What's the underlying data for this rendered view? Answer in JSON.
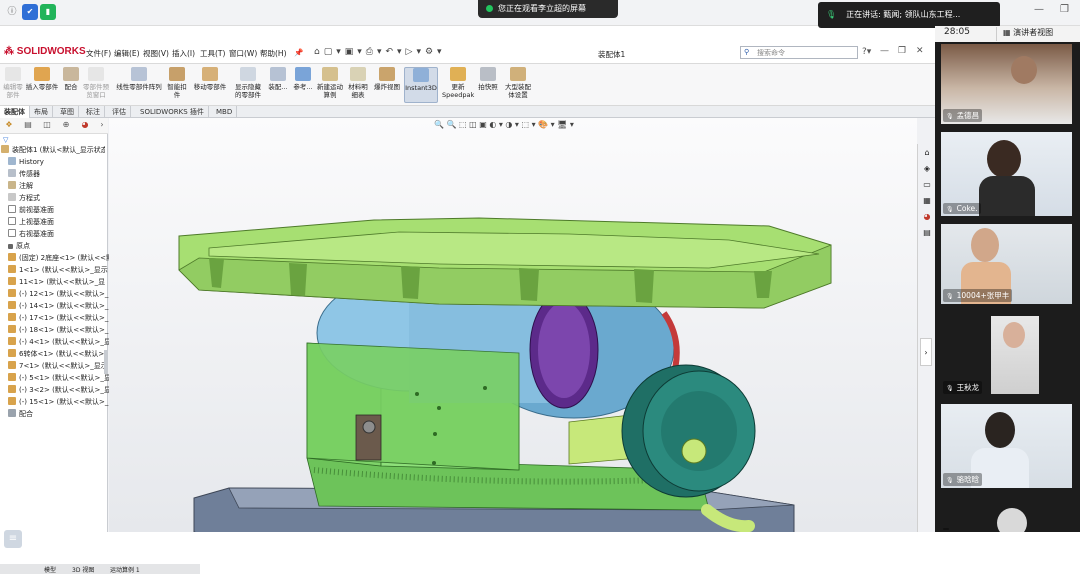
{
  "meeting": {
    "share_banner": "您正在观看李立超的屏幕",
    "speaking_label": "正在讲话: 甄闻; 领队山东工程...",
    "timer": "28:05",
    "view_mode": "演讲者视图",
    "top_icons": [
      "info-icon",
      "shield-icon",
      "signal-icon"
    ],
    "participants": [
      {
        "name": "孟德昌"
      },
      {
        "name": "Coke."
      },
      {
        "name": "10004+张甲丰"
      },
      {
        "name": "王秋龙"
      },
      {
        "name": "骆晗晗"
      },
      {
        "name": ""
      }
    ]
  },
  "solidworks": {
    "logo": "SOLIDWORKS",
    "menu": [
      "文件(F)",
      "编辑(E)",
      "视图(V)",
      "插入(I)",
      "工具(T)",
      "窗口(W)",
      "帮助(H)"
    ],
    "doc_title": "装配体1",
    "search_placeholder": "搜索命令",
    "ribbon": [
      {
        "label": "编辑零部件"
      },
      {
        "label": "插入零部件"
      },
      {
        "label": "配合"
      },
      {
        "label": "零部件预览窗口"
      },
      {
        "label": "线性零部件阵列"
      },
      {
        "label": "智能扣件"
      },
      {
        "label": "移动零部件"
      },
      {
        "label": "显示隐藏的零部件"
      },
      {
        "label": "装配..."
      },
      {
        "label": "参考..."
      },
      {
        "label": "新建运动算例"
      },
      {
        "label": "材料明细表"
      },
      {
        "label": "爆炸视图"
      },
      {
        "label": "Instant3D"
      },
      {
        "label": "更新 Speedpak"
      },
      {
        "label": "拍快照"
      },
      {
        "label": "大型装配体设置"
      }
    ],
    "tabs": [
      "装配体",
      "布局",
      "草图",
      "标注",
      "评估",
      "SOLIDWORKS 插件",
      "MBD"
    ],
    "tree": [
      {
        "label": "装配体1 (默认<默认_显示状态"
      },
      {
        "label": "History"
      },
      {
        "label": "传感器"
      },
      {
        "label": "注解"
      },
      {
        "label": "方程式"
      },
      {
        "label": "前视基准面"
      },
      {
        "label": "上视基准面"
      },
      {
        "label": "右视基准面"
      },
      {
        "label": "原点"
      },
      {
        "label": "(固定) 2底座<1> (默认<<默"
      },
      {
        "label": "1<1> (默认<<默认>_显示"
      },
      {
        "label": "11<1> (默认<<默认>_显"
      },
      {
        "label": "(-) 12<1> (默认<<默认>_"
      },
      {
        "label": "(-) 14<1> (默认<<默认>_"
      },
      {
        "label": "(-) 17<1> (默认<<默认>_"
      },
      {
        "label": "(-) 18<1> (默认<<默认>_"
      },
      {
        "label": "(-) 4<1> (默认<<默认>_显"
      },
      {
        "label": "6转体<1> (默认<<默认>_"
      },
      {
        "label": "7<1> (默认<<默认>_显示"
      },
      {
        "label": "(-) 5<1> (默认<<默认>_显"
      },
      {
        "label": "(-) 3<2> (默认<<默认>_显"
      },
      {
        "label": "(-) 15<1> (默认<<默认>_"
      },
      {
        "label": "配合"
      }
    ],
    "bottom_tabs": [
      "模型",
      "3D 视图",
      "运动算例 1"
    ]
  }
}
